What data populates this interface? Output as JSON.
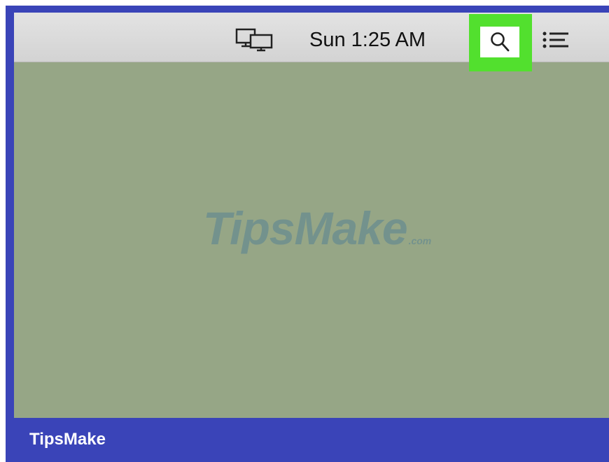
{
  "menubar": {
    "airplay_icon": "airplay-display-icon",
    "clock": "Sun 1:25 AM",
    "search_icon": "spotlight-search-icon",
    "list_icon": "notification-center-icon"
  },
  "desktop": {
    "watermark_main": "TipsMake",
    "watermark_suffix": ".com"
  },
  "footer": {
    "brand": "TipsMake"
  },
  "colors": {
    "frame": "#3a44b8",
    "desktop": "#96a686",
    "highlight": "#52e02e",
    "menubar": "#d9d9d9"
  }
}
